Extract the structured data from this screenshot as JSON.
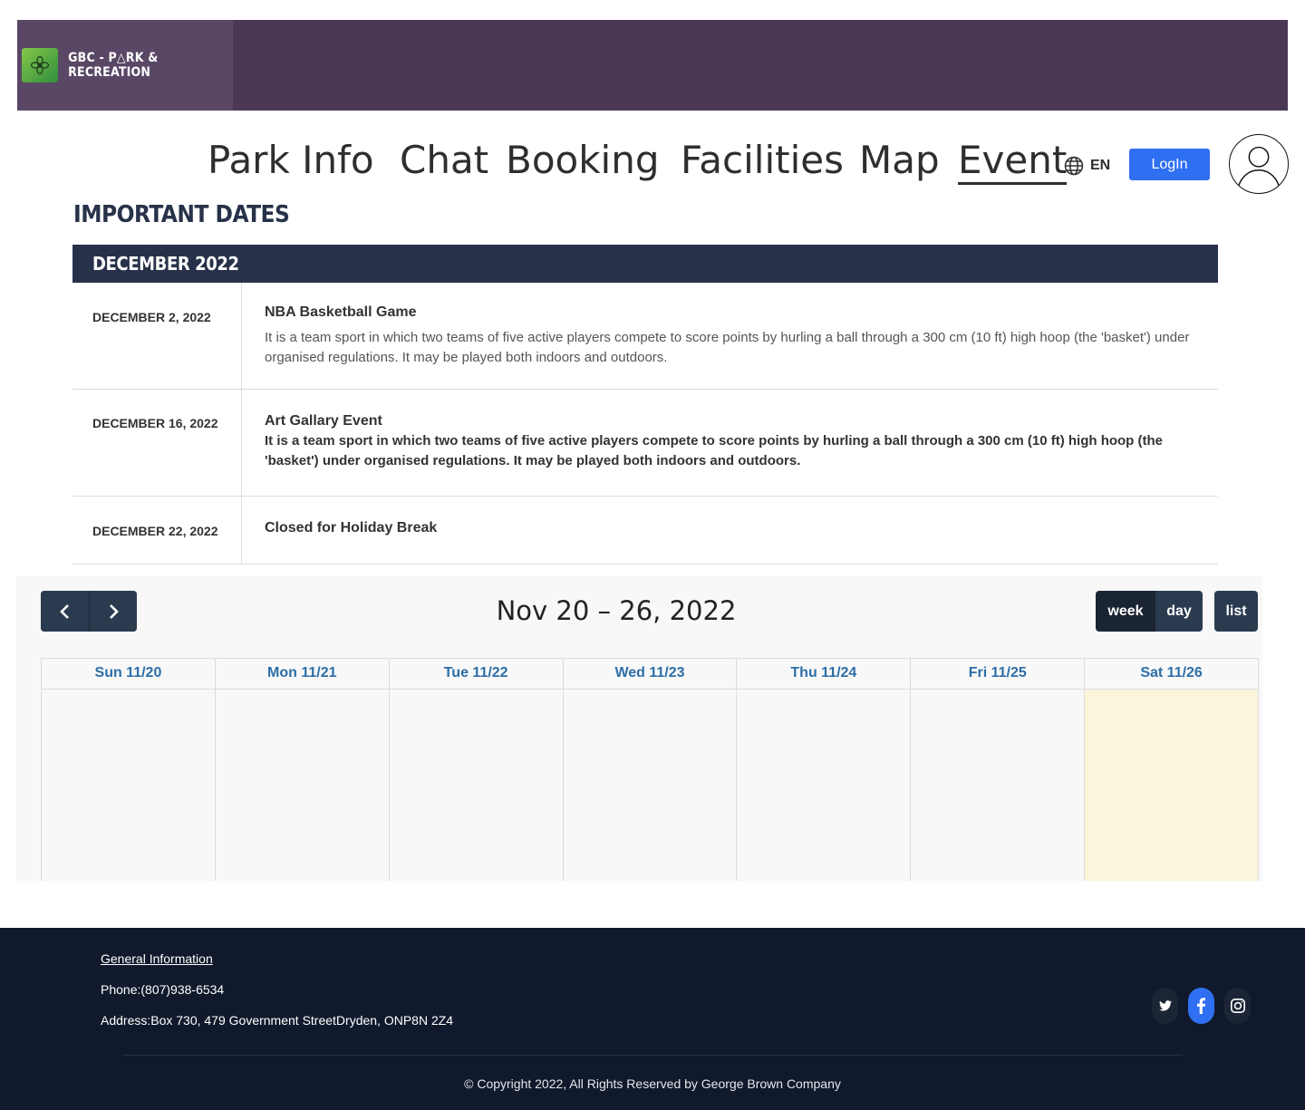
{
  "brand": {
    "name": "GBC - P△RK & RECREATION",
    "logo_icon": "flower-icon"
  },
  "nav": {
    "items": [
      {
        "label": "Park Info",
        "active": false
      },
      {
        "label": "Chat",
        "active": false
      },
      {
        "label": "Booking",
        "active": false
      },
      {
        "label": "Facilities",
        "active": false
      },
      {
        "label": "Map",
        "active": false
      },
      {
        "label": "Event",
        "active": true
      }
    ],
    "language": "EN",
    "language_icon": "globe-icon",
    "login_label": "LogIn",
    "avatar_icon": "user-icon"
  },
  "important_dates": {
    "heading": "IMPORTANT DATES",
    "month": "DECEMBER 2022",
    "events": [
      {
        "date": "DECEMBER 2, 2022",
        "title": "NBA Basketball Game",
        "description": "It is a team sport in which two teams of five active players compete to score points by hurling a ball through a 300 cm (10 ft) high hoop (the 'basket') under organised regulations. It may be played both indoors and outdoors."
      },
      {
        "date": "DECEMBER 16, 2022",
        "title": "Art Gallary Event",
        "description": "It is a team sport in which two teams of five active players compete to score points by hurling a ball through a 300 cm (10 ft) high hoop (the 'basket') under organised regulations. It may be played both indoors and outdoors."
      },
      {
        "date": "DECEMBER 22, 2022",
        "title": "Closed for Holiday Break",
        "description": ""
      }
    ]
  },
  "calendar": {
    "title": "Nov 20 – 26, 2022",
    "prev_icon": "chevron-left-icon",
    "next_icon": "chevron-right-icon",
    "views": {
      "week": "week",
      "day": "day",
      "list": "list"
    },
    "active_view": "week",
    "days": [
      {
        "label": "Sun 11/20",
        "today": false
      },
      {
        "label": "Mon 11/21",
        "today": false
      },
      {
        "label": "Tue 11/22",
        "today": false
      },
      {
        "label": "Wed 11/23",
        "today": false
      },
      {
        "label": "Thu 11/24",
        "today": false
      },
      {
        "label": "Fri 11/25",
        "today": false
      },
      {
        "label": "Sat 11/26",
        "today": true
      }
    ]
  },
  "footer": {
    "general_info": "General Information",
    "phone": "Phone:(807)938-6534",
    "address": "Address:Box 730, 479 Government StreetDryden, ONP8N 2Z4",
    "social": [
      "twitter-icon",
      "facebook-icon",
      "instagram-icon"
    ],
    "copyright": "© Copyright 2022, All Rights Reserved by George Brown Company"
  },
  "colors": {
    "banner": "#4a3856",
    "navy": "#27324a",
    "accent_blue": "#2f6ff1",
    "footer_bg": "#101a2c",
    "today_bg": "#fbf5dc"
  }
}
